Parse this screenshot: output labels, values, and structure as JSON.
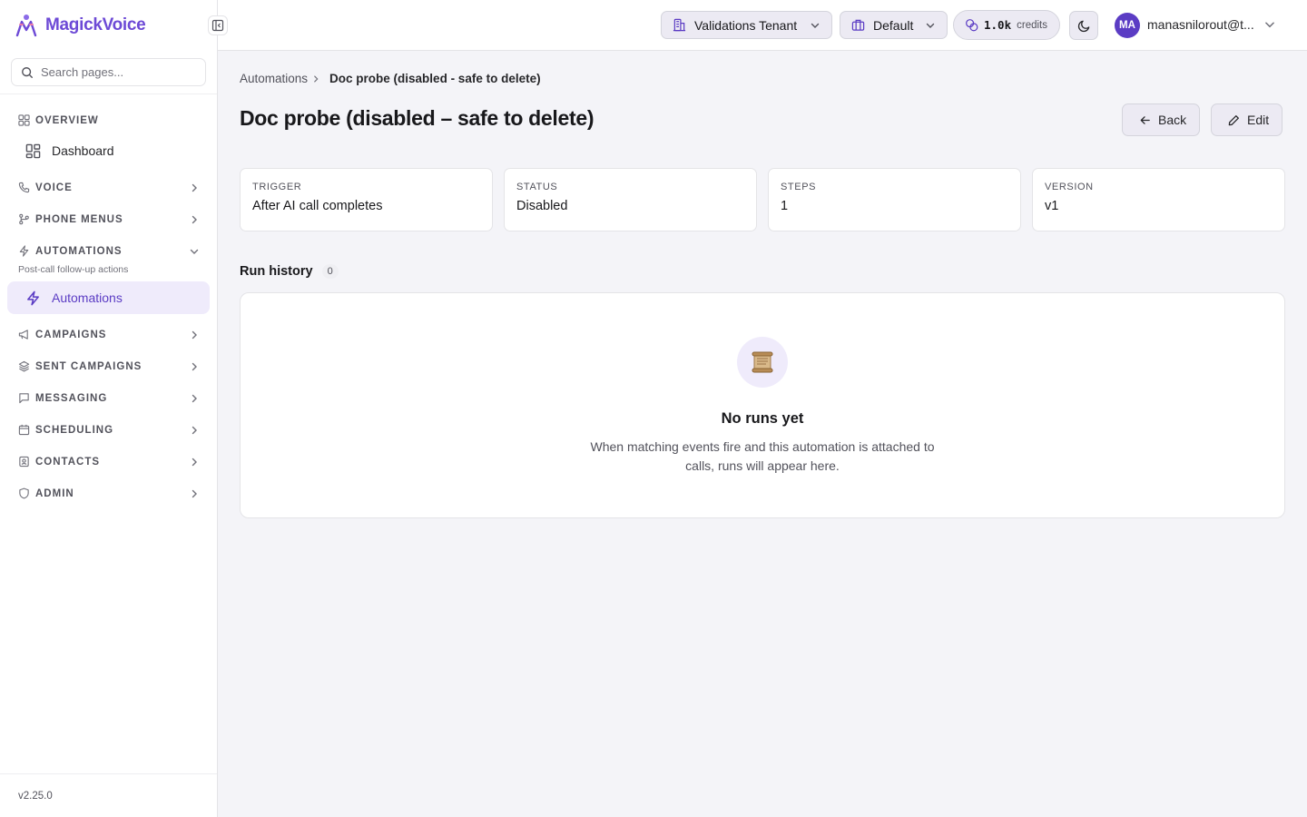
{
  "app": {
    "name": "MagickVoice",
    "version": "v2.25.0"
  },
  "search": {
    "placeholder": "Search pages..."
  },
  "sidebar": {
    "overview": {
      "label": "OVERVIEW",
      "items": [
        {
          "label": "Dashboard"
        }
      ]
    },
    "voice": {
      "label": "VOICE"
    },
    "phone_menus": {
      "label": "PHONE MENUS"
    },
    "automations": {
      "label": "AUTOMATIONS",
      "subtitle": "Post-call follow-up actions",
      "items": [
        {
          "label": "Automations",
          "active": true
        }
      ]
    },
    "campaigns": {
      "label": "CAMPAIGNS"
    },
    "sent_campaigns": {
      "label": "SENT CAMPAIGNS"
    },
    "messaging": {
      "label": "MESSAGING"
    },
    "scheduling": {
      "label": "SCHEDULING"
    },
    "contacts": {
      "label": "CONTACTS"
    },
    "admin": {
      "label": "ADMIN"
    }
  },
  "topbar": {
    "tenant": "Validations Tenant",
    "workspace": "Default",
    "credits": {
      "value": "1.0k",
      "unit": "credits"
    },
    "user": {
      "initials": "MA",
      "name": "manasnilorout@t..."
    }
  },
  "breadcrumb": {
    "parent": "Automations",
    "current": "Doc probe (disabled - safe to delete)"
  },
  "page": {
    "title": "Doc probe (disabled – safe to delete)",
    "back_label": "Back",
    "edit_label": "Edit"
  },
  "stats": [
    {
      "key": "TRIGGER",
      "value": "After AI call completes"
    },
    {
      "key": "STATUS",
      "value": "Disabled"
    },
    {
      "key": "STEPS",
      "value": "1"
    },
    {
      "key": "VERSION",
      "value": "v1"
    }
  ],
  "run_history": {
    "title": "Run history",
    "count": "0",
    "empty_title": "No runs yet",
    "empty_description": "When matching events fire and this automation is attached to calls, runs will appear here."
  },
  "colors": {
    "accent": "#5b3cc4",
    "accent_bg": "#efebfb",
    "surface": "#f4f4f8"
  },
  "icons": {
    "brand": "magickvoice-logo-icon",
    "empty_state": "scroll-icon"
  }
}
